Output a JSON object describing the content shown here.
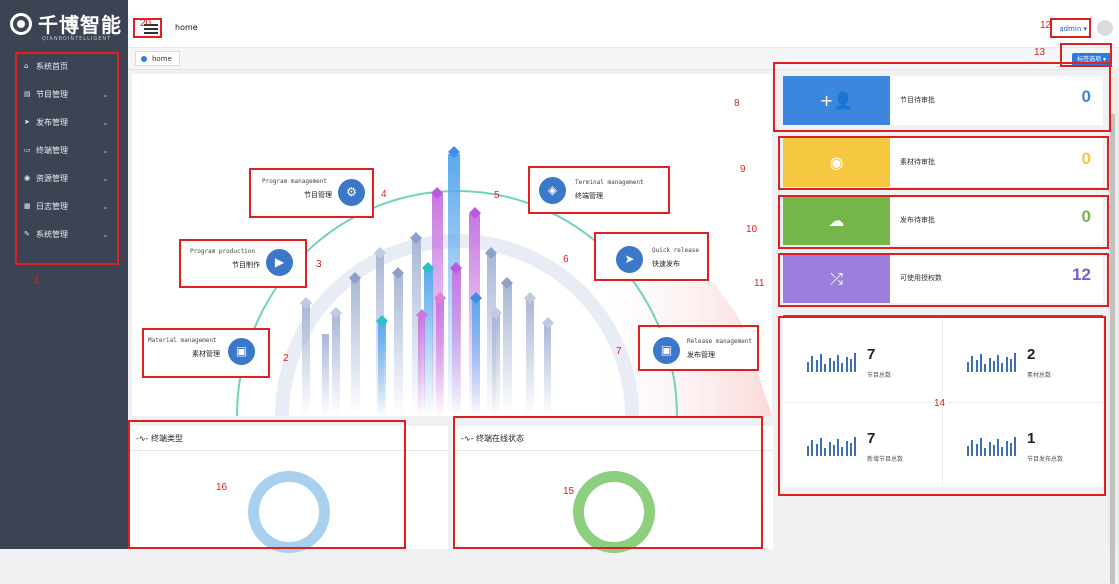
{
  "brand": {
    "title": "千博智能",
    "subtitle": "QIANBOINTELLIGENT"
  },
  "header": {
    "title": "home",
    "user": "admin ▾"
  },
  "breadcrumb": {
    "label": "home",
    "tab_options": "标签选项 ▾"
  },
  "sidebar": {
    "items": [
      {
        "icon": "home-icon",
        "glyph": "⌂",
        "label": "系统首页",
        "chevron": ""
      },
      {
        "icon": "program-icon",
        "glyph": "▤",
        "label": "节目管理",
        "chevron": "⌄"
      },
      {
        "icon": "send-icon",
        "glyph": "➤",
        "label": "发布管理",
        "chevron": "⌄"
      },
      {
        "icon": "monitor-icon",
        "glyph": "▭",
        "label": "终端管理",
        "chevron": "⌄"
      },
      {
        "icon": "resource-icon",
        "glyph": "◉",
        "label": "资源管理",
        "chevron": "⌄"
      },
      {
        "icon": "log-icon",
        "glyph": "▦",
        "label": "日志管理",
        "chevron": "⌄"
      },
      {
        "icon": "wrench-icon",
        "glyph": "✎",
        "label": "系统管理",
        "chevron": "⌄"
      }
    ]
  },
  "modules": {
    "program_management": {
      "en": "Program management",
      "zh": "节目管理",
      "icon": "user-gear-icon",
      "glyph": "⚙"
    },
    "program_production": {
      "en": "Program production",
      "zh": "节目制作",
      "icon": "play-icon",
      "glyph": "▶"
    },
    "material_management": {
      "en": "Material management",
      "zh": "素材管理",
      "icon": "image-icon",
      "glyph": "▣"
    },
    "terminal_management": {
      "en": "Terminal management",
      "zh": "终端管理",
      "icon": "layers-icon",
      "glyph": "◈"
    },
    "quick_release": {
      "en": "Quick release",
      "zh": "快速发布",
      "icon": "paper-plane-icon",
      "glyph": "➤"
    },
    "release_management": {
      "en": "Release management",
      "zh": "发布管理",
      "icon": "release-icon",
      "glyph": "▣"
    }
  },
  "cards": [
    {
      "label": "节目待审批",
      "value": "0",
      "color": "#3d86dd",
      "value_color": "#3d86dd",
      "icon": "add-user-icon",
      "glyph": "+👤"
    },
    {
      "label": "素材待审批",
      "value": "0",
      "color": "#f6c842",
      "value_color": "#f6c842",
      "icon": "eye-icon",
      "glyph": "◉"
    },
    {
      "label": "发布待审批",
      "value": "0",
      "color": "#74b64a",
      "value_color": "#74b64a",
      "icon": "cloud-upload-icon",
      "glyph": "☁"
    },
    {
      "label": "可使用授权数",
      "value": "12",
      "color": "#9b7fdc",
      "value_color": "#7b5bd0",
      "icon": "shuffle-icon",
      "glyph": "⤮"
    }
  ],
  "stats": [
    {
      "value": "7",
      "label": "节目总数"
    },
    {
      "value": "2",
      "label": "素材总数"
    },
    {
      "value": "7",
      "label": "新增节目总数"
    },
    {
      "value": "1",
      "label": "节目发布总数"
    }
  ],
  "panels": {
    "terminal_type": {
      "title": "-∿- 终端类型",
      "ring_color": "#a9d0ef"
    },
    "terminal_online": {
      "title": "-∿- 终端在线状态",
      "ring_color": "#8ccf7e"
    }
  },
  "annotations": [
    "1",
    "2",
    "3",
    "4",
    "5",
    "6",
    "7",
    "8",
    "9",
    "10",
    "11",
    "12",
    "13",
    "14",
    "15",
    "16",
    "20"
  ]
}
